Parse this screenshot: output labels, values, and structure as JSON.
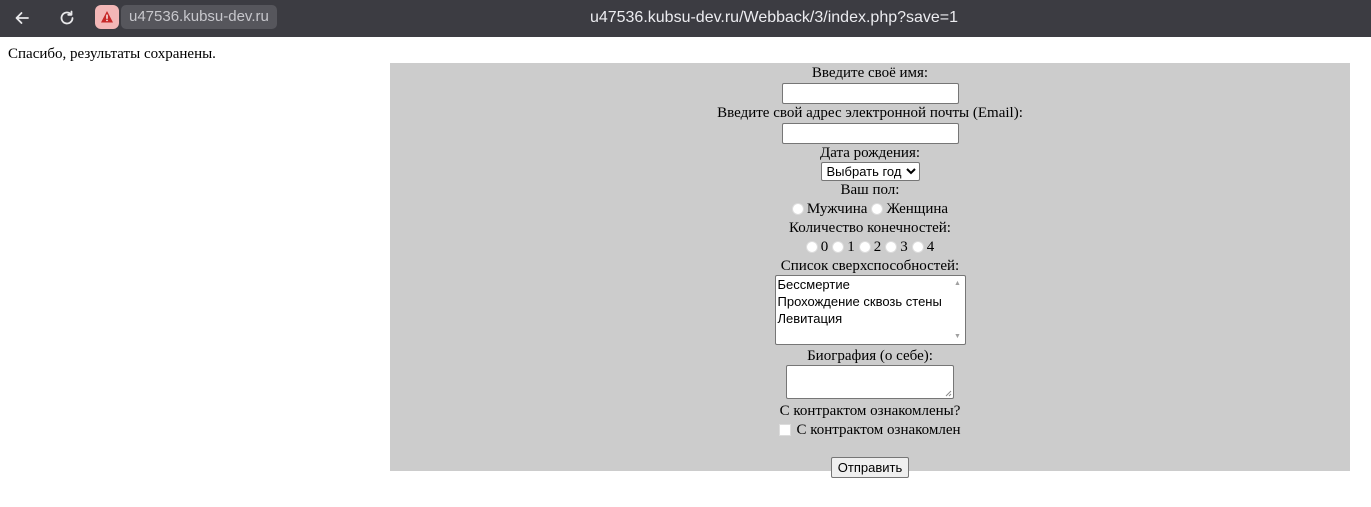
{
  "browser": {
    "domain": "u47536.kubsu-dev.ru",
    "url": "u47536.kubsu-dev.ru/Webback/3/index.php?save=1",
    "back_icon": "arrow-left-icon",
    "reload_icon": "reload-icon",
    "security_icon": "warning-triangle-icon",
    "security_color": "#f3b7b7"
  },
  "page": {
    "message": "Спасибо, результаты сохранены.",
    "panel_color": "#cccccc"
  },
  "form": {
    "name_label": "Введите своё имя:",
    "name_value": "",
    "email_label": "Введите свой адрес электронной почты (Email):",
    "email_value": "",
    "birth_label": "Дата рождения:",
    "birth_selected": "Выбрать год",
    "gender_label": "Ваш пол:",
    "gender_options": [
      "Мужчина",
      "Женщина"
    ],
    "limbs_label": "Количество конечностей:",
    "limbs_options": [
      "0",
      "1",
      "2",
      "3",
      "4"
    ],
    "abilities_label": "Список сверхспособностей:",
    "abilities_options": [
      "Бессмертие",
      "Прохождение сквозь стены",
      "Левитация"
    ],
    "bio_label": "Биография (о себе):",
    "contract_label": "С контрактом ознакомлены?",
    "contract_checkbox_label": "С контрактом ознакомлен",
    "submit_label": "Отправить"
  }
}
